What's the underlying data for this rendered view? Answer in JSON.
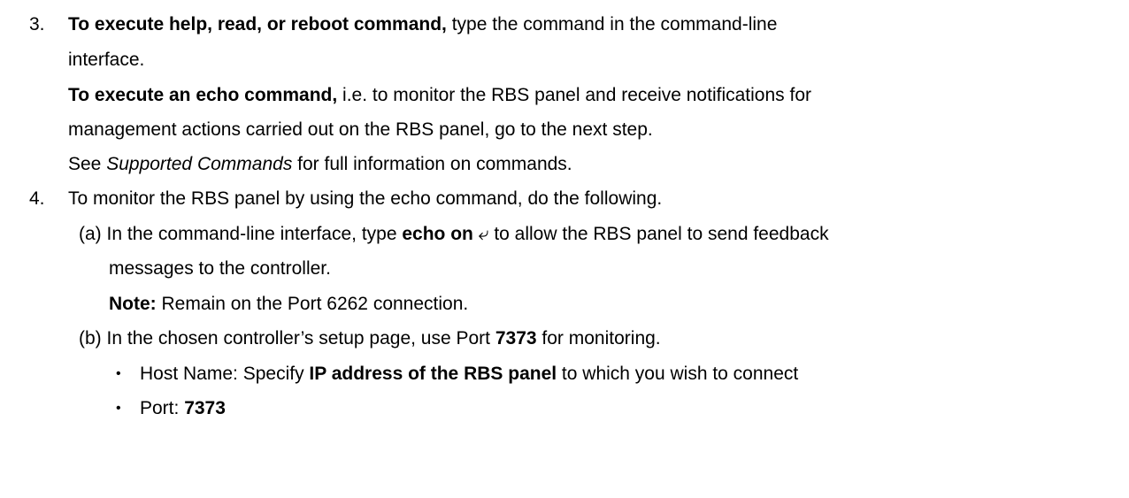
{
  "step3": {
    "number": "3.",
    "line1_bold": "To execute help, read, or reboot command,",
    "line1_rest": " type the command in the command-line",
    "line2": "interface.",
    "line3_bold": "To execute an echo command,",
    "line3_rest": " i.e. to monitor the RBS panel and receive notifications for",
    "line4": "management actions carried out on the RBS panel, go to the next step.",
    "line5_pre": "See ",
    "line5_italic": "Supported Commands",
    "line5_post": " for full information on commands."
  },
  "step4": {
    "number": "4.",
    "intro": "To monitor the RBS panel by using the echo command, do the following.",
    "sub_a": {
      "label": "(a)",
      "pre": "In the command-line interface, type ",
      "bold": "echo on",
      "enter_symbol": "⤶",
      "post": " to allow the RBS panel to send feedback",
      "line2": "messages to the controller.",
      "note_label": "Note:",
      "note_text": " Remain on the Port 6262 connection."
    },
    "sub_b": {
      "label": "(b)",
      "pre": "In the chosen controller’s setup page, use Port ",
      "bold": "7373",
      "post": " for monitoring.",
      "bullets": [
        {
          "pre": "Host Name: Specify ",
          "bold": "IP address of the RBS panel",
          "post": " to which you wish to connect"
        },
        {
          "pre": "Port: ",
          "bold": "7373",
          "post": ""
        }
      ]
    }
  }
}
